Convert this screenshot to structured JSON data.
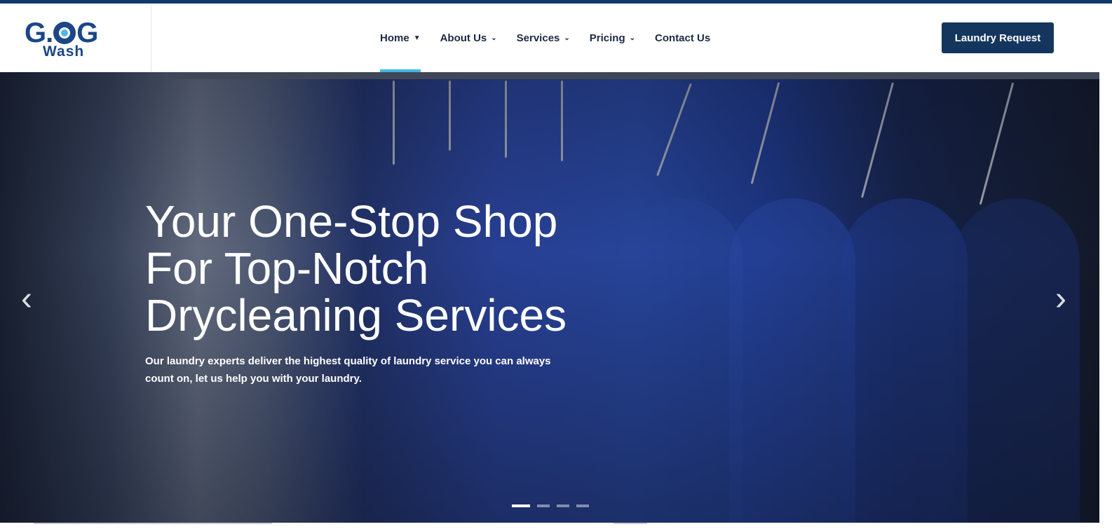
{
  "brand": {
    "logo_top_left": "G.",
    "logo_top_right": "G",
    "logo_bottom": "Wash"
  },
  "nav": {
    "items": [
      {
        "label": "Home",
        "has_dropdown": true,
        "active": true
      },
      {
        "label": "About Us",
        "has_dropdown": true
      },
      {
        "label": "Services",
        "has_dropdown": true
      },
      {
        "label": "Pricing",
        "has_dropdown": true
      },
      {
        "label": "Contact Us",
        "has_dropdown": false
      }
    ],
    "cta_label": "Laundry Request"
  },
  "hero": {
    "headline": "Your One-Stop Shop For Top-Notch Drycleaning Services",
    "subtext": "Our laundry experts deliver the highest quality of laundry service you can always count on, let us help you with your laundry.",
    "prev_icon": "chevron-left-icon",
    "next_icon": "chevron-right-icon",
    "slides_count": 4,
    "active_slide": 1
  },
  "colors": {
    "accent": "#3fb8de",
    "brand": "#14365e",
    "topbar": "#0f3a68"
  }
}
